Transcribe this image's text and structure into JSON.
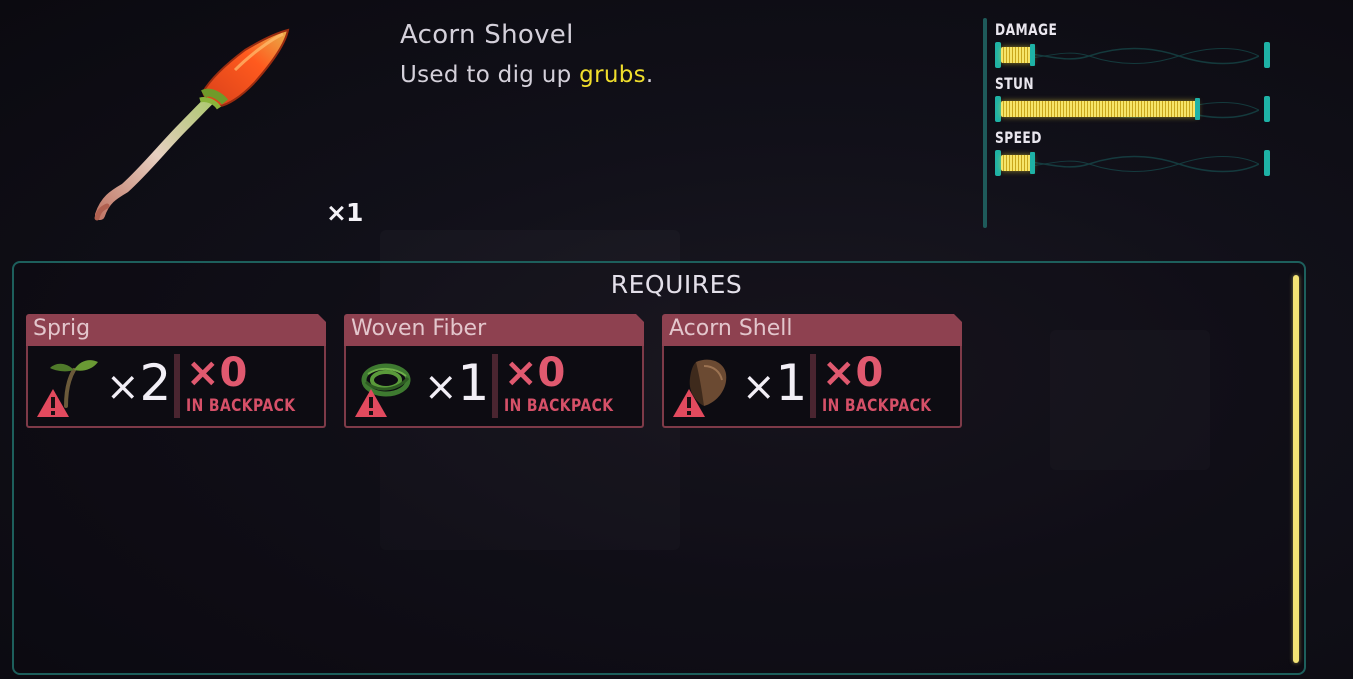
{
  "item": {
    "name": "Acorn Shovel",
    "description_prefix": "Used to dig up ",
    "description_highlight": "grubs",
    "description_suffix": ".",
    "count": "×1",
    "icon": "acorn-shovel-icon"
  },
  "stats": [
    {
      "label": "DAMAGE",
      "value": 0.12
    },
    {
      "label": "STUN",
      "value": 0.75
    },
    {
      "label": "SPEED",
      "value": 0.12
    }
  ],
  "requires": {
    "title": "REQUIRES",
    "items": [
      {
        "name": "Sprig",
        "x": "×",
        "required": "2",
        "have": "×0",
        "have_label": "IN BACKPACK",
        "icon": "sprig-icon"
      },
      {
        "name": "Woven Fiber",
        "x": "×",
        "required": "1",
        "have": "×0",
        "have_label": "IN BACKPACK",
        "icon": "woven-fiber-icon"
      },
      {
        "name": "Acorn Shell",
        "x": "×",
        "required": "1",
        "have": "×0",
        "have_label": "IN BACKPACK",
        "icon": "acorn-shell-icon"
      }
    ]
  },
  "colors": {
    "accent_teal": "#1eb2a6",
    "stat_fill": "#f6e56a",
    "card_header": "#8e4150",
    "missing_red": "#e0596f",
    "highlight_yellow": "#f0de2c"
  }
}
